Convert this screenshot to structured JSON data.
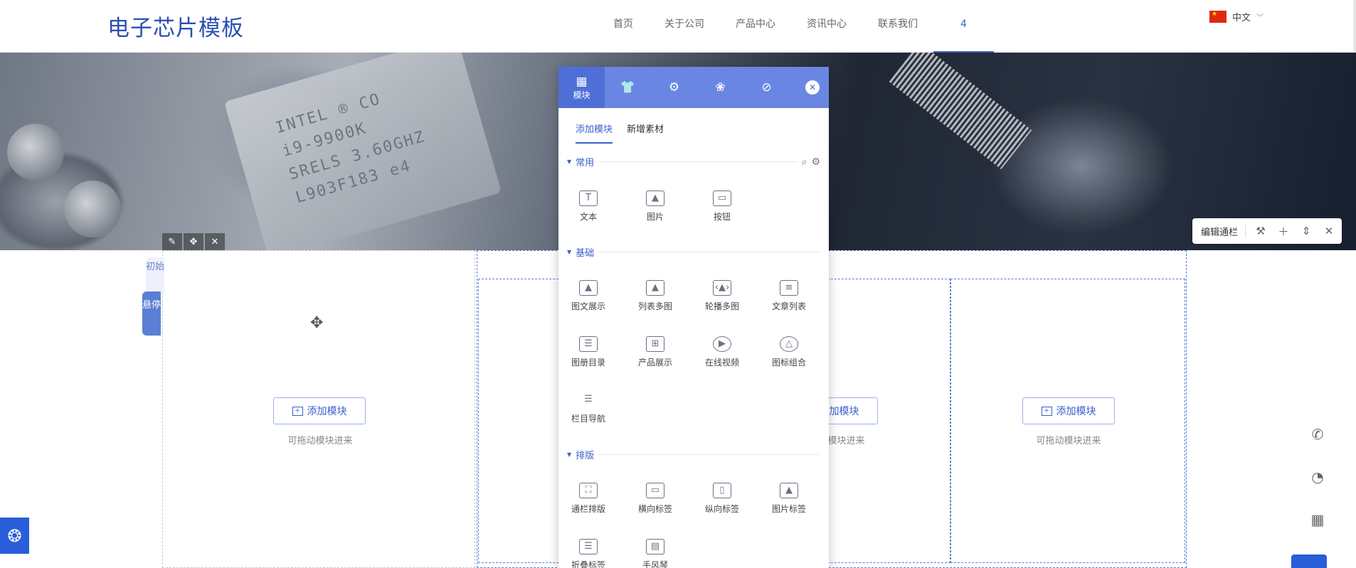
{
  "header": {
    "logo": "电子芯片模板",
    "nav": [
      "首页",
      "关于公司",
      "产品中心",
      "资讯中心",
      "联系我们",
      "4"
    ],
    "lang": "中文"
  },
  "banner": {
    "chip_text": "INTEL ® CO\ni9-9900K\nSRELS 3.60GHZ\nL903F183 e4"
  },
  "edit_bar": {
    "label": "编辑通栏"
  },
  "side_tabs": {
    "init": "初始",
    "hover": "悬停"
  },
  "columns": {
    "add_label": "添加模块",
    "drag_hint": "可拖动模块进来"
  },
  "panel": {
    "tabs": [
      {
        "icon": "grid-icon",
        "label": "模块"
      },
      {
        "icon": "shirt-icon",
        "label": ""
      },
      {
        "icon": "gear-icon",
        "label": ""
      },
      {
        "icon": "paw-icon",
        "label": ""
      },
      {
        "icon": "link-icon",
        "label": ""
      }
    ],
    "subtabs": [
      "添加模块",
      "新增素材"
    ],
    "sections": {
      "common": "常用",
      "basic": "基础",
      "layout": "排版"
    },
    "common_modules": [
      "文本",
      "图片",
      "按钮"
    ],
    "basic_modules": [
      "图文展示",
      "列表多图",
      "轮播多图",
      "文章列表",
      "图册目录",
      "产品展示",
      "在线视频",
      "图标组合",
      "栏目导航"
    ],
    "layout_modules": [
      "通栏排版",
      "横向标签",
      "纵向标签",
      "图片标签",
      "折叠标签",
      "手风琴"
    ]
  }
}
